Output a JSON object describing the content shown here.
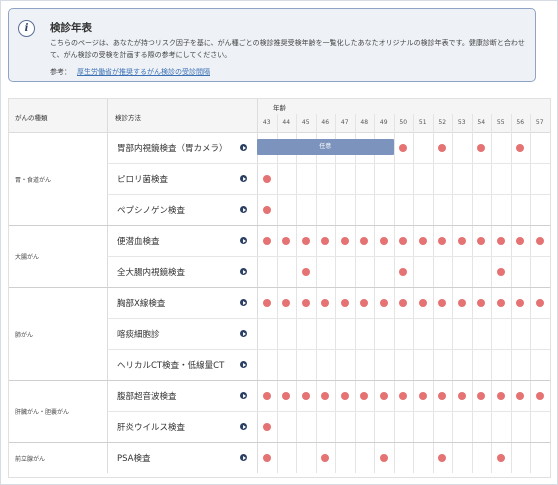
{
  "info": {
    "icon": "info-icon",
    "title": "検診年表",
    "description": "こちらのページは、あなたが持つリスク因子を基に、がん種ごとの検診推奨受検年齢を一覧化したあなたオリジナルの検診年表です。健康診断と合わせて、がん検診の受検を計画する際の参考にしてください。",
    "ref_label": "参考：",
    "ref_link": "厚生労働省が推奨するがん検診の受診間隔"
  },
  "table": {
    "header_category": "がんの種類",
    "header_method": "検診方法",
    "header_age": "年齢",
    "ages": [
      "43",
      "44",
      "45",
      "46",
      "47",
      "48",
      "49",
      "50",
      "51",
      "52",
      "53",
      "54",
      "55",
      "56",
      "57"
    ],
    "dot_color": "#e57373",
    "bar_color": "#7c93bd",
    "categories": [
      {
        "label": "胃・食道がん",
        "rows": [
          0,
          1,
          2
        ]
      },
      {
        "label": "大腸がん",
        "rows": [
          3,
          4
        ]
      },
      {
        "label": "肺がん",
        "rows": [
          5,
          6,
          7
        ]
      },
      {
        "label": "肝臓がん・胆嚢がん",
        "rows": [
          8,
          9
        ]
      },
      {
        "label": "前立腺がん",
        "rows": [
          10
        ]
      }
    ],
    "rows": [
      {
        "method": "胃部内視鏡検査（胃カメラ）",
        "bar": {
          "from": 0,
          "to": 6,
          "label": "任意"
        },
        "dots": [
          7,
          9,
          11,
          13
        ]
      },
      {
        "method": "ピロリ菌検査",
        "dots": [
          0
        ]
      },
      {
        "method": "ペプシノゲン検査",
        "dots": [
          0
        ]
      },
      {
        "method": "便潜血検査",
        "dots": [
          0,
          1,
          2,
          3,
          4,
          5,
          6,
          7,
          8,
          9,
          10,
          11,
          12,
          13,
          14
        ]
      },
      {
        "method": "全大腸内視鏡検査",
        "dots": [
          2,
          7,
          12
        ]
      },
      {
        "method": "胸部X線検査",
        "dots": [
          0,
          1,
          2,
          3,
          4,
          5,
          6,
          7,
          8,
          9,
          10,
          11,
          12,
          13,
          14
        ]
      },
      {
        "method": "喀痰細胞診",
        "dots": []
      },
      {
        "method": "ヘリカルCT検査・低線量CT",
        "dots": []
      },
      {
        "method": "腹部超音波検査",
        "dots": [
          0,
          1,
          2,
          3,
          4,
          5,
          6,
          7,
          8,
          9,
          10,
          11,
          12,
          13,
          14
        ]
      },
      {
        "method": "肝炎ウイルス検査",
        "dots": [
          0
        ]
      },
      {
        "method": "PSA検査",
        "dots": [
          0,
          3,
          6,
          9,
          12
        ]
      }
    ]
  }
}
